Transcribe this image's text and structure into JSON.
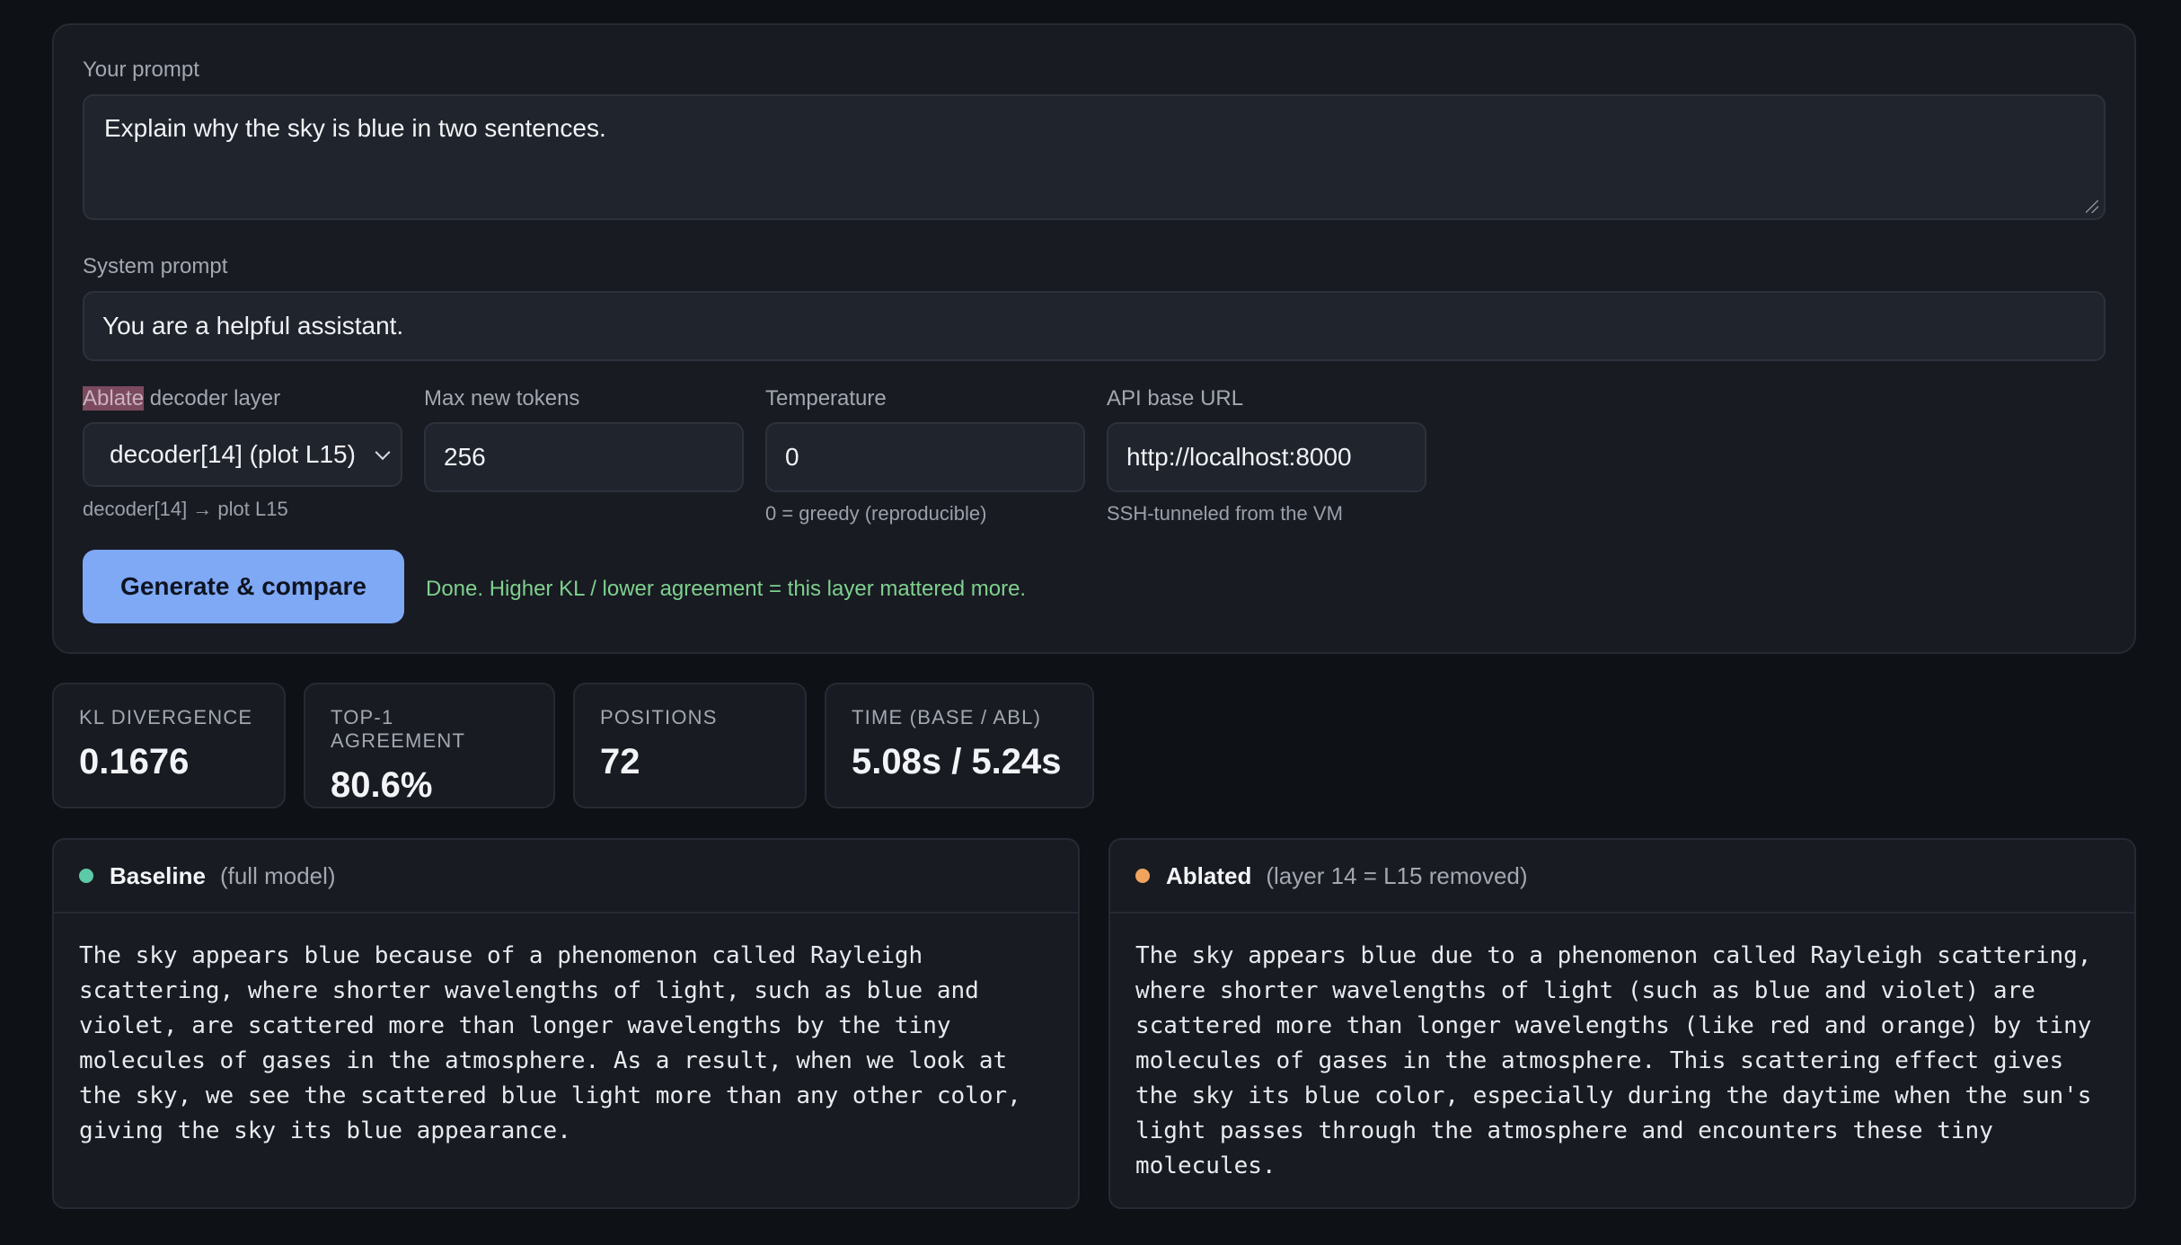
{
  "prompt": {
    "label": "Your prompt",
    "value": "Explain why the sky is blue in two sentences."
  },
  "system_prompt": {
    "label": "System prompt",
    "value": "You are a helpful assistant."
  },
  "ablate_layer": {
    "label_highlight": "Ablate",
    "label_rest": " decoder layer",
    "selected": "decoder[14] (plot L15)",
    "hint": "decoder[14] → plot L15"
  },
  "max_tokens": {
    "label": "Max new tokens",
    "value": "256"
  },
  "temperature": {
    "label": "Temperature",
    "value": "0",
    "hint": "0 = greedy (reproducible)"
  },
  "api_base": {
    "label": "API base URL",
    "value": "http://localhost:8000",
    "hint": "SSH-tunneled from the VM"
  },
  "generate_button": "Generate & compare",
  "status_text": "Done. Higher KL / lower agreement = this layer mattered more.",
  "stats": [
    {
      "label": "KL DIVERGENCE",
      "value": "0.1676"
    },
    {
      "label": "TOP-1 AGREEMENT",
      "value": "80.6%"
    },
    {
      "label": "POSITIONS",
      "value": "72"
    },
    {
      "label": "TIME (BASE / ABL)",
      "value": "5.08s / 5.24s"
    }
  ],
  "baseline": {
    "title": "Baseline",
    "subtitle": "(full model)",
    "dot_color": "#5ec9a6",
    "text": "The sky appears blue because of a phenomenon called Rayleigh\nscattering, where shorter wavelengths of light, such as blue and\nviolet, are scattered more than longer wavelengths by the tiny\nmolecules of gases in the atmosphere. As a result, when we look at\nthe sky, we see the scattered blue light more than any other color,\ngiving the sky its blue appearance."
  },
  "ablated": {
    "title": "Ablated",
    "subtitle": "(layer 14 = L15 removed)",
    "dot_color": "#f0a45e",
    "text": "The sky appears blue due to a phenomenon called Rayleigh scattering,\nwhere shorter wavelengths of light (such as blue and violet) are\nscattered more than longer wavelengths (like red and orange) by tiny\nmolecules of gases in the atmosphere. This scattering effect gives\nthe sky its blue color, especially during the daytime when the sun's\nlight passes through the atmosphere and encounters these tiny\nmolecules."
  }
}
